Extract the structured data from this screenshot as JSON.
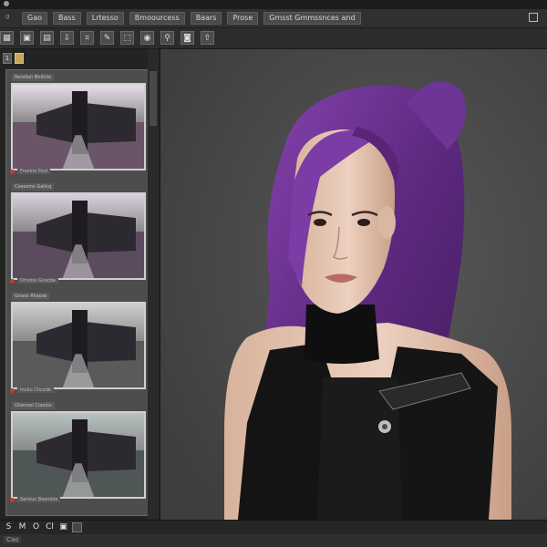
{
  "menu": {
    "items": [
      "Gao",
      "Bass",
      "Lrtesso",
      "Bmoourcess",
      "Baars",
      "Prose",
      "Gmsst Gmmssnces and"
    ]
  },
  "toolbar": {
    "tools": [
      {
        "icon": "grid-icon",
        "glyph": "▦"
      },
      {
        "icon": "frame-icon",
        "glyph": "▣"
      },
      {
        "icon": "layers-icon",
        "glyph": "▤"
      },
      {
        "icon": "import-icon",
        "glyph": "⇩"
      },
      {
        "icon": "crop-icon",
        "glyph": "⌗"
      },
      {
        "icon": "brush-icon",
        "glyph": "✎"
      },
      {
        "icon": "select-icon",
        "glyph": "⬚"
      },
      {
        "icon": "eye-icon",
        "glyph": "◉"
      },
      {
        "icon": "search-icon",
        "glyph": "⚲"
      },
      {
        "icon": "camera-icon",
        "glyph": "◙"
      },
      {
        "icon": "export-icon",
        "glyph": "⇧"
      }
    ]
  },
  "panel": {
    "tabs": [
      "1",
      ""
    ],
    "thumbnails": [
      {
        "label": "Rerolion Bnilicts",
        "caption": "Frooine Pool",
        "sky": "#e8dce8",
        "ground": "#6a5468",
        "tone": "purple"
      },
      {
        "label": "Ceesoms Galing",
        "caption": "Dmntio Goocbe",
        "sky": "#dacfe0",
        "ground": "#5c4a5e",
        "tone": "purple"
      },
      {
        "label": "Gnaos Rilaiow",
        "caption": "Inoliu Chcxde",
        "sky": "#cfcfcf",
        "ground": "#5a5a5a",
        "tone": "gray"
      },
      {
        "label": "Ghenoel Ciaoiov",
        "caption": "Sarsiuc Baaniole",
        "sky": "#b7c3c1",
        "ground": "#4f5656",
        "tone": "teal"
      }
    ]
  },
  "canvas": {
    "image_desc": "portrait",
    "hair_color": "#6b2f8f",
    "skin_color": "#e4c5b2",
    "bg_color": "#4a4a4a"
  },
  "statusbar": {
    "buttons": [
      "S",
      "M",
      "O",
      "Cl",
      "▣",
      ""
    ]
  },
  "footer": {
    "label": "Cao"
  }
}
